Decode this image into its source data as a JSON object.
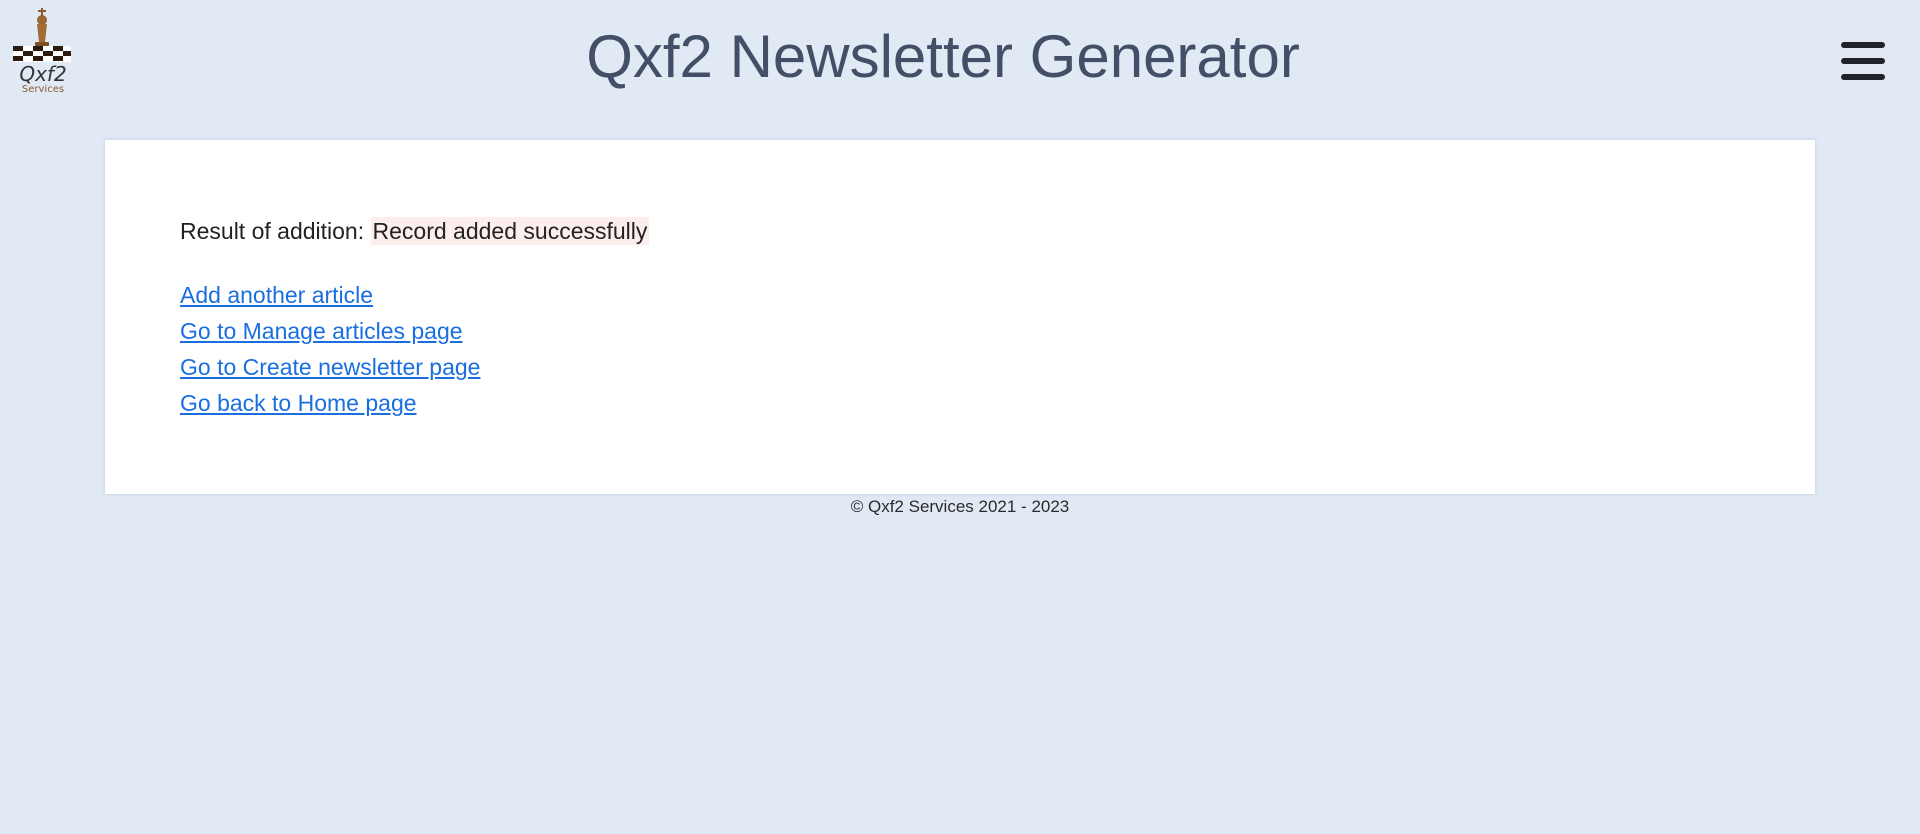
{
  "header": {
    "title": "Qxf2 Newsletter Generator",
    "logo": {
      "text": "Qxf2",
      "subtext": "Services"
    },
    "menu_icon": "hamburger-menu-icon"
  },
  "main": {
    "result_label": "Result of addition:",
    "result_value": "Record added successfully",
    "links": [
      {
        "label": "Add another article"
      },
      {
        "label": "Go to Manage articles page"
      },
      {
        "label": "Go to Create newsletter page"
      },
      {
        "label": "Go back to Home page"
      }
    ]
  },
  "footer": {
    "text": "© Qxf2 Services 2021 - 2023"
  },
  "colors": {
    "background": "#e1e9f5",
    "title": "#434f66",
    "link": "#1a6fe0",
    "result_highlight": "#fdeeee"
  }
}
